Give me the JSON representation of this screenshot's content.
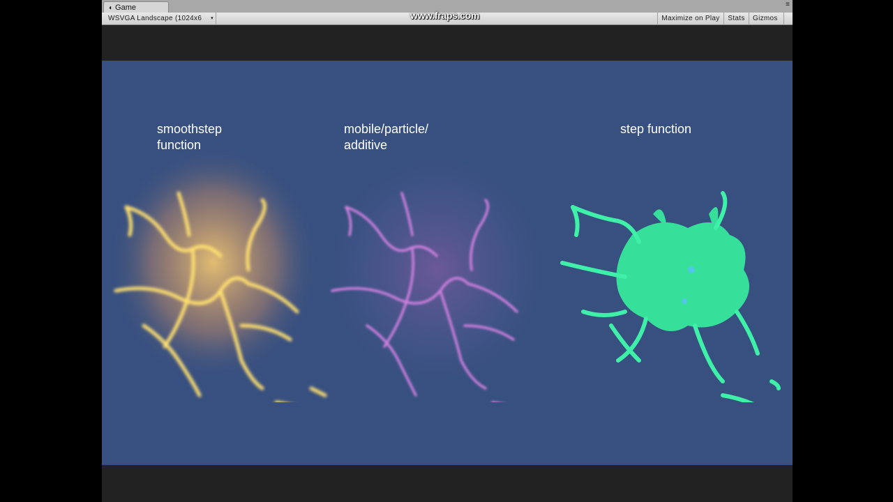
{
  "window": {
    "tab_label": "Game",
    "tab_icon": "unity-logo-icon",
    "tab_menu_icon": "≡"
  },
  "toolbar": {
    "aspect_label": "WSVGA Landscape (1024x6",
    "aspect_arrow": "▾",
    "maximize_label": "Maximize on Play",
    "stats_label": "Stats",
    "gizmos_label": "Gizmos",
    "gizmos_arrow": "▾"
  },
  "watermark": "www.fraps.com",
  "scene": {
    "labels": {
      "smoothstep": "smoothstep\nfunction",
      "particle": "mobile/particle/\nadditive",
      "step": "step function"
    },
    "colors": {
      "background": "#385080",
      "smoothstep": "#ffd060",
      "particle": "#c070d8",
      "step": "#30f0a0"
    }
  }
}
